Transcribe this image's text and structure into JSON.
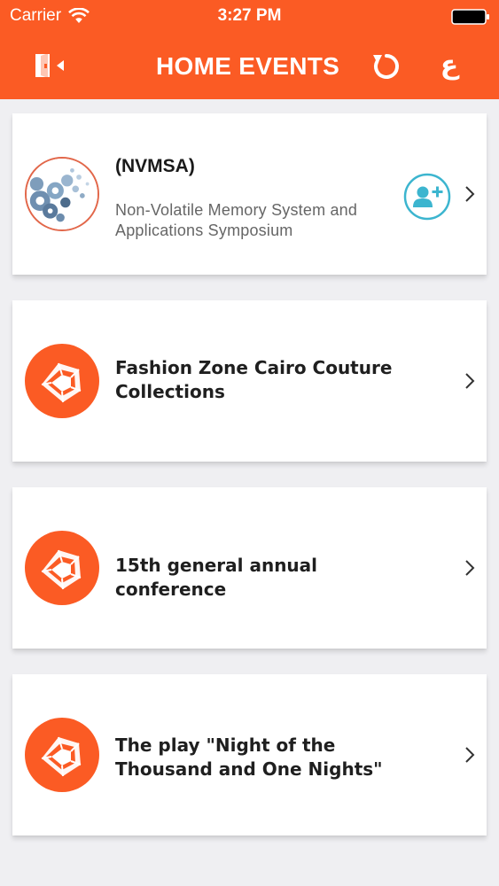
{
  "status_bar": {
    "carrier": "Carrier",
    "time": "3:27 PM",
    "wifi_icon": "wifi-icon",
    "battery_icon": "battery-icon"
  },
  "nav": {
    "title": "HOME EVENTS",
    "lang_label": "ع",
    "left_icon": "exit-icon",
    "refresh_icon": "refresh-icon"
  },
  "colors": {
    "accent": "#fb5b24",
    "register_accent": "#3cb5cf",
    "background": "#efeff2"
  },
  "events": [
    {
      "title": "(NVMSA)",
      "subtitle": "Non-Volatile Memory System and Applications Symposium",
      "thumbnail": "gears-image",
      "action_icon": "register-user-icon"
    },
    {
      "title": "Fashion Zone Cairo Couture Collections",
      "thumbnail": "event-logo"
    },
    {
      "title": "15th general annual conference",
      "thumbnail": "event-logo"
    },
    {
      "title": "The play \"Night of the Thousand and One Nights\"",
      "thumbnail": "event-logo"
    }
  ]
}
